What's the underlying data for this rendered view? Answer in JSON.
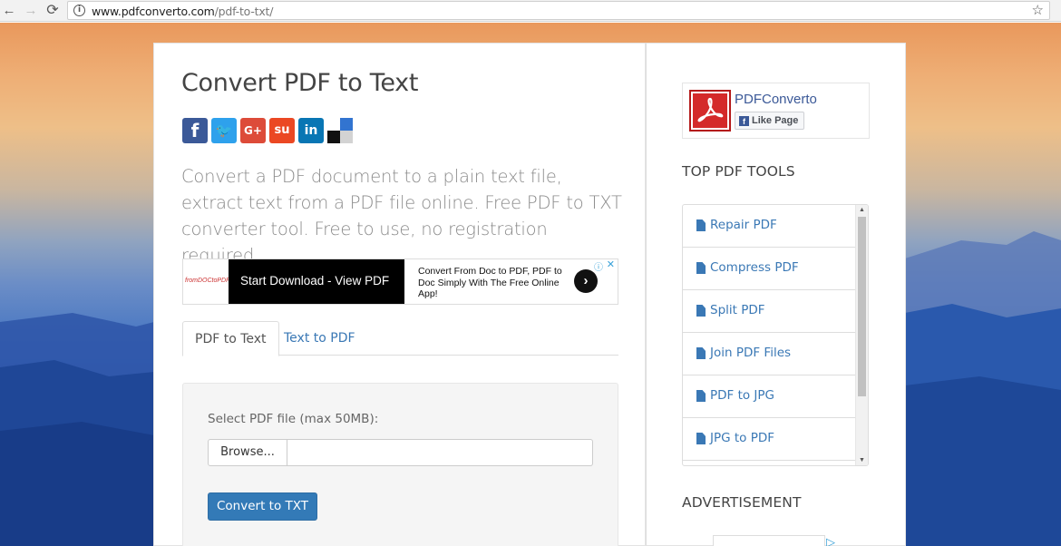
{
  "browser": {
    "back_icon": "←",
    "forward_icon": "→",
    "reload_icon": "C",
    "info_icon": "i",
    "url_host": "www.pdfconverto.com",
    "url_path": "/pdf-to-txt/",
    "star_icon": "☆"
  },
  "main": {
    "title": "Convert PDF to Text",
    "social": {
      "facebook": "f",
      "twitter": "t",
      "googleplus": "G+",
      "stumbleupon": "su",
      "linkedin": "in"
    },
    "description": "Convert a PDF document to a plain text file, extract text from a PDF file online. Free PDF to TXT converter tool. Free to use, no registration required.",
    "ad": {
      "logo": "fromDOCtoPDF",
      "cta": "Start Download - View PDF",
      "text": "Convert From Doc to PDF, PDF to Doc Simply With The Free Online App!",
      "arrow": "›",
      "info": "ⓘ",
      "close": "✕"
    },
    "tabs": [
      {
        "label": "PDF to Text",
        "active": true
      },
      {
        "label": "Text to PDF",
        "active": false
      }
    ],
    "form": {
      "file_label": "Select PDF file (max 50MB):",
      "browse_label": "Browse...",
      "file_value": "",
      "convert_label": "Convert to TXT"
    }
  },
  "sidebar": {
    "fb": {
      "page_name": "PDFConverto",
      "like_icon": "f",
      "like_label": "Like Page"
    },
    "tools_heading": "TOP PDF TOOLS",
    "tools": [
      {
        "label": "Repair PDF"
      },
      {
        "label": "Compress PDF"
      },
      {
        "label": "Split PDF"
      },
      {
        "label": "Join PDF Files"
      },
      {
        "label": "PDF to JPG"
      },
      {
        "label": "JPG to PDF"
      }
    ],
    "ad_heading": "ADVERTISEMENT",
    "ad_icon": "▷"
  },
  "colors": {
    "accent": "#337ab7",
    "link": "#3a78b5",
    "facebook": "#3b5998"
  }
}
